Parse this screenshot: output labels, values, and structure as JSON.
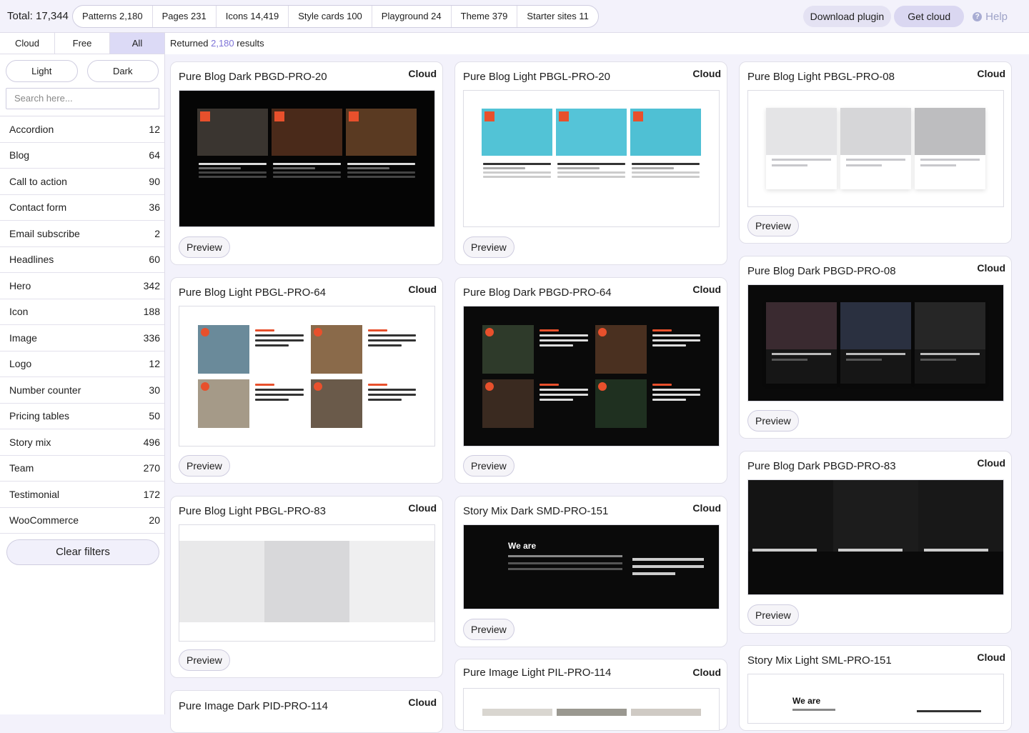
{
  "topbar": {
    "total": "Total: 17,344",
    "tabs": [
      "Patterns 2,180",
      "Pages 231",
      "Icons 14,419",
      "Style cards 100",
      "Playground 24",
      "Theme 379",
      "Starter sites 11"
    ],
    "download_label": "Download plugin",
    "cloud_label": "Get cloud",
    "help_label": "Help",
    "help_glyph": "?"
  },
  "sidebar": {
    "scope_tabs": [
      "Cloud",
      "Free",
      "All"
    ],
    "active_scope": "All",
    "mode_light": "Light",
    "mode_dark": "Dark",
    "search_placeholder": "Search here...",
    "categories": [
      {
        "name": "Accordion",
        "count": "12"
      },
      {
        "name": "Blog",
        "count": "64"
      },
      {
        "name": "Call to action",
        "count": "90"
      },
      {
        "name": "Contact form",
        "count": "36"
      },
      {
        "name": "Email subscribe",
        "count": "2"
      },
      {
        "name": "Headlines",
        "count": "60"
      },
      {
        "name": "Hero",
        "count": "342"
      },
      {
        "name": "Icon",
        "count": "188"
      },
      {
        "name": "Image",
        "count": "336"
      },
      {
        "name": "Logo",
        "count": "12"
      },
      {
        "name": "Number counter",
        "count": "30"
      },
      {
        "name": "Pricing tables",
        "count": "50"
      },
      {
        "name": "Story mix",
        "count": "496"
      },
      {
        "name": "Team",
        "count": "270"
      },
      {
        "name": "Testimonial",
        "count": "172"
      },
      {
        "name": "WooCommerce",
        "count": "20"
      }
    ],
    "clear_label": "Clear filters"
  },
  "results": {
    "prefix": "Returned",
    "count": "2,180",
    "suffix": "results"
  },
  "cards": {
    "c1": {
      "title": "Pure Blog Dark PBGD-PRO-20",
      "badge": "Cloud",
      "preview": "Preview"
    },
    "c2": {
      "title": "Pure Blog Light PBGL-PRO-64",
      "badge": "Cloud",
      "preview": "Preview"
    },
    "c3": {
      "title": "Pure Blog Light PBGL-PRO-83",
      "badge": "Cloud",
      "preview": "Preview"
    },
    "c4": {
      "title": "Pure Image Dark PID-PRO-114",
      "badge": "Cloud"
    },
    "c5": {
      "title": "Pure Blog Light PBGL-PRO-20",
      "badge": "Cloud",
      "preview": "Preview"
    },
    "c6": {
      "title": "Pure Blog Dark PBGD-PRO-64",
      "badge": "Cloud",
      "preview": "Preview"
    },
    "c7": {
      "title": "Story Mix Dark SMD-PRO-151",
      "badge": "Cloud",
      "preview": "Preview",
      "heading": "We are"
    },
    "c8": {
      "title": "Pure Image Light PIL-PRO-114",
      "badge": "Cloud"
    },
    "c9": {
      "title": "Pure Blog Light PBGL-PRO-08",
      "badge": "Cloud",
      "preview": "Preview"
    },
    "c10": {
      "title": "Pure Blog Dark PBGD-PRO-08",
      "badge": "Cloud",
      "preview": "Preview"
    },
    "c11": {
      "title": "Pure Blog Dark PBGD-PRO-83",
      "badge": "Cloud",
      "preview": "Preview"
    },
    "c12": {
      "title": "Story Mix Light SML-PRO-151",
      "badge": "Cloud",
      "heading": "We are"
    }
  },
  "colors": {
    "accent": "#7e74d8",
    "active_tab": "#dcdaf6",
    "tag": "#e8502c"
  }
}
